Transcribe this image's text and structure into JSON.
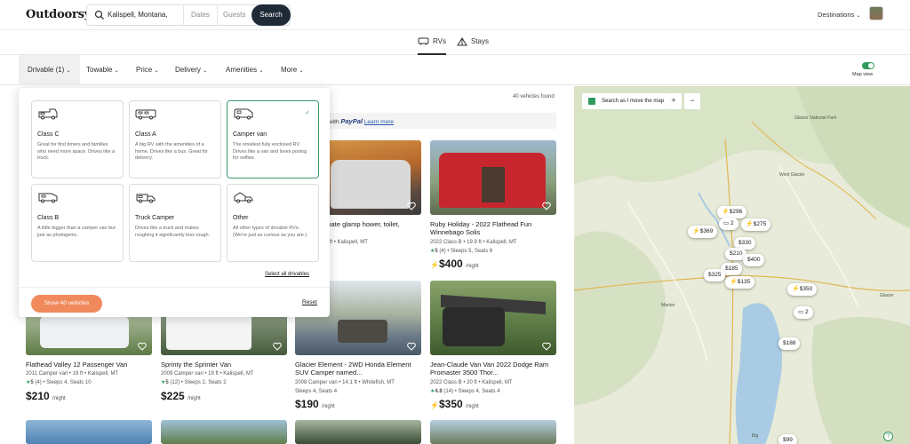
{
  "header": {
    "logo": "Outdoorsy",
    "location": "Kalispell, Montana,",
    "dates_placeholder": "Dates",
    "guests_placeholder": "Guests",
    "search_label": "Search",
    "destinations": "Destinations"
  },
  "tabs": [
    {
      "label": "RVs",
      "active": true
    },
    {
      "label": "Stays",
      "active": false
    }
  ],
  "filters": [
    "Drivable (1)",
    "Towable",
    "Price",
    "Delivery",
    "Amenities",
    "More"
  ],
  "map_view_label": "Map view",
  "vehicle_count": "40 vehicles found",
  "paypal": {
    "pre": "with",
    "brand": "PayPal",
    "link": "Learn more"
  },
  "popup": {
    "options": [
      {
        "name": "Class C",
        "desc": "Great for first timers and families who need more space. Drives like a truck.",
        "selected": false
      },
      {
        "name": "Class A",
        "desc": "A big RV with the amenities of a home. Drives like a bus. Great for delivery.",
        "selected": false
      },
      {
        "name": "Camper van",
        "desc": "The smallest fully enclosed RV. Drives like a van and loves posing for selfies.",
        "selected": true
      },
      {
        "name": "Class B",
        "desc": "A little bigger than a camper van but just as photogenic.",
        "selected": false
      },
      {
        "name": "Truck Camper",
        "desc": "Drives like a truck and makes roughing it significantly less rough.",
        "selected": false
      },
      {
        "name": "Other",
        "desc": "All other types of drivable RVs. (We're just as curious as you are.)",
        "selected": false
      }
    ],
    "select_all": "Select all drivables",
    "show_button": "Show 40 vehicles",
    "reset": "Reset"
  },
  "cards": [
    {
      "title": "Transit ultimate glamp hower, toilet, slideout...",
      "meta": "mper van • 24 ft • Kalispell, MT",
      "meta2": "eps 2, Seats 2",
      "price": "ight",
      "instant": false
    },
    {
      "title": "Ruby Holiday - 2022 Flathead Fun Winnebago Solis",
      "meta": "2022 Class B • 19.9 ft • Kalispell, MT",
      "rating": "5",
      "reviews": "(4) • Sleeps 5, Seats 6",
      "price": "$400",
      "per": "/night",
      "instant": true
    },
    {
      "title": "Flathead Valley 12 Passenger Van",
      "meta": "2011 Camper van • 19 ft • Kalispell, MT",
      "rating": "5",
      "reviews": "(4) • Sleeps 4, Seats 10",
      "price": "$210",
      "per": "/night",
      "instant": false
    },
    {
      "title": "Sprinty the Sprinter Van",
      "meta": "2009 Camper van • 19 ft • Kalispell, MT",
      "rating": "5",
      "reviews": "(12) • Sleeps 2, Seats 2",
      "price": "$225",
      "per": "/night",
      "instant": false
    },
    {
      "title": "Glacier Element - 2WD Honda Element SUV Camper named...",
      "meta": "2008 Camper van • 14.1 ft • Whitefish, MT",
      "meta2": "Sleeps 4, Seats 4",
      "price": "$190",
      "per": "/night",
      "instant": false
    },
    {
      "title": "Jean-Claude Van Van 2022 Dodge Ram Promaster 3500 Thor...",
      "meta": "2022 Class B • 20 ft • Kalispell, MT",
      "rating": "4.8",
      "reviews": "(14) • Sleeps 4, Seats 4",
      "price": "$350",
      "per": "/night",
      "instant": true
    }
  ],
  "map": {
    "search_as_move": "Search as I move the map",
    "zoom_in": "+",
    "zoom_out": "−",
    "labels": [
      "Glacier National Park",
      "West Glacier",
      "Glacier",
      "Marion",
      "Big"
    ],
    "pins": [
      "$296",
      "2",
      "$275",
      "$369",
      "$330",
      "$210",
      "$400",
      "$185",
      "$325",
      "$135",
      "$350",
      "2",
      "$188",
      "$99"
    ]
  },
  "colors": {
    "accent": "#2f9a5b",
    "cta": "#f08a5d",
    "search_btn": "#1f2a37"
  }
}
